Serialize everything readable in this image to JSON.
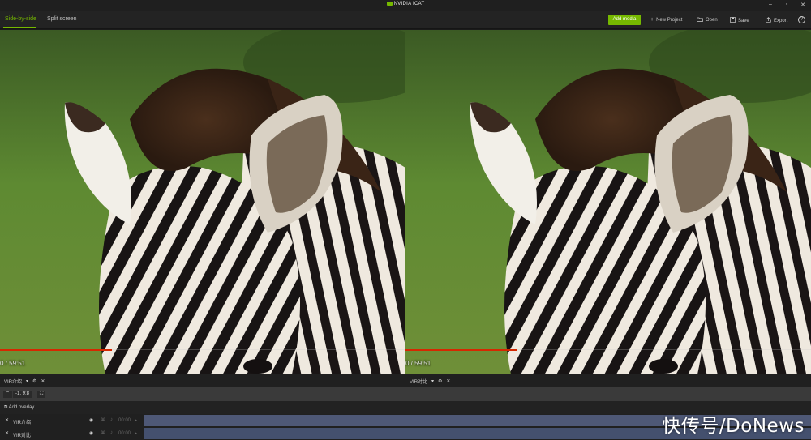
{
  "window": {
    "title": "NVIDIA ICAT"
  },
  "window_controls": [
    "–",
    "▫",
    "✕"
  ],
  "toolbar": {
    "tabs": [
      {
        "label": "Side-by-side",
        "active": true
      },
      {
        "label": "Split screen",
        "active": false
      }
    ],
    "add_media_label": "Add media",
    "new_project_label": "New Project",
    "open_label": "Open",
    "save_label": "Save",
    "export_label": "Export",
    "help_icon": "?"
  },
  "viewers": [
    {
      "timecode": "0 / 59:51",
      "label": "VIR介绍",
      "progress": 0.276
    },
    {
      "timecode": "0 / 59:51",
      "label": "VIR对比",
      "progress": 0.276
    }
  ],
  "timeline": {
    "zoom_label": "-1, 9:8",
    "add_overlay_label": "Add overlay",
    "tracks": [
      {
        "name": "VIR介绍",
        "time": "00:00"
      },
      {
        "name": "VIR对比",
        "time": "00:00"
      }
    ]
  },
  "watermark": "快传号/DoNews",
  "colors": {
    "accent": "#76b900",
    "progress": "#d62800",
    "track_bar": "#4e5876"
  }
}
